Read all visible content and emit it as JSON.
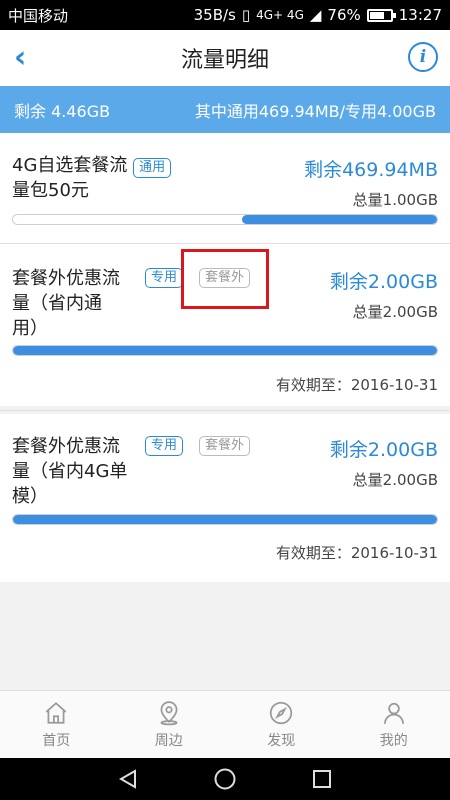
{
  "status": {
    "carrier": "中国移动",
    "speed": "35B/s",
    "network": "4G+ 4G",
    "battery": "76%",
    "battery_level": 0.76,
    "time": "13:27"
  },
  "header": {
    "title": "流量明细"
  },
  "summary": {
    "remaining": "剩余 4.46GB",
    "breakdown": "其中通用469.94MB/专用4.00GB"
  },
  "packages": [
    {
      "name_line1": "4G自选套餐流",
      "name_line2": "量包50元",
      "tags": [
        "通用"
      ],
      "remaining": "剩余469.94MB",
      "total": "总量1.00GB",
      "remaining_fraction": 0.46
    },
    {
      "name_line1": "套餐外优惠流",
      "name_line2": "量（省内通",
      "name_line3": "用）",
      "tags": [
        "专用",
        "套餐外"
      ],
      "remaining": "剩余2.00GB",
      "total": "总量2.00GB",
      "remaining_fraction": 1.0,
      "expiry": "有效期至：2016-10-31"
    },
    {
      "name_line1": "套餐外优惠流",
      "name_line2": "量（省内4G单",
      "name_line3": "模）",
      "tags": [
        "专用",
        "套餐外"
      ],
      "remaining": "剩余2.00GB",
      "total": "总量2.00GB",
      "remaining_fraction": 1.0,
      "expiry": "有效期至：2016-10-31"
    }
  ],
  "tabbar": {
    "home": "首页",
    "nearby": "周边",
    "discover": "发现",
    "mine": "我的"
  },
  "colors": {
    "accent": "#2b8ad8",
    "summary_bg": "#5ba9e8",
    "highlight": "#d9181e"
  }
}
